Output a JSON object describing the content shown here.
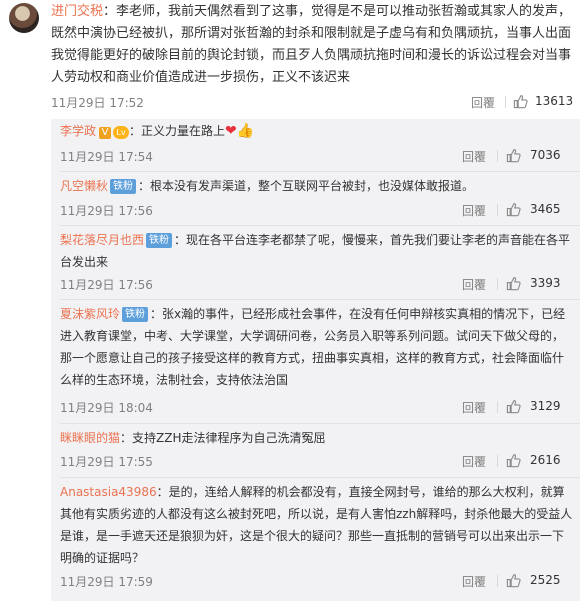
{
  "main_comment": {
    "username": "进门交税",
    "text": "：李老师，我前天偶然看到了这事，觉得是不是可以推动张哲瀚或其家人的发声，既然中演协已经被扒，那所谓对张哲瀚的封杀和限制就是子虚乌有和负隅顽抗，当事人出面我觉得能更好的破除目前的舆论封锁，而且歹人负隅顽抗拖时间和漫长的诉讼过程会对当事人劳动权和商业价值造成进一步损伤，正义不该迟来",
    "date": "11月29日 17:52",
    "reply_label": "回覆",
    "likes": "13613"
  },
  "replies": [
    {
      "username": "李学政",
      "badges": [
        "V",
        "Lv"
      ],
      "text": "：正义力量在路上",
      "emoji": [
        "heart",
        "thumbs-up"
      ],
      "date": "11月29日 17:54",
      "reply_label": "回覆",
      "likes": "7036"
    },
    {
      "username": "凡空懒秋",
      "fan_badge": "铁粉",
      "text": "：根本没有发声渠道，整个互联网平台被封，也没媒体敢报道。",
      "date": "11月29日 17:56",
      "reply_label": "回覆",
      "likes": "3465"
    },
    {
      "username": "梨花落尽月也西",
      "fan_badge": "铁粉",
      "text": "：现在各平台连李老都禁了呢，慢慢来，首先我们要让李老的声音能在各平台发出来",
      "date": "11月29日 17:56",
      "reply_label": "回覆",
      "likes": "3393"
    },
    {
      "username": "夏沫紫风玲",
      "fan_badge": "铁粉",
      "text": "：张x瀚的事件，已经形成社会事件，在没有任何申辩核实真相的情况下，已经进入教育课堂，中考、大学课堂，大学调研问卷，公务员入职等系列问题。试问天下做父母的，那一个愿意让自己的孩子接受这样的教育方式，扭曲事实真相，这样的教育方式，社会降面临什么样的生态环境，法制社会，支持依法治国",
      "date": "11月29日 18:04",
      "reply_label": "回覆",
      "likes": "3129"
    },
    {
      "username": "眯眯眼的猫",
      "text": "：支持ZZH走法律程序为自己洗清冤屈",
      "date": "11月29日 17:55",
      "reply_label": "回覆",
      "likes": "2616"
    },
    {
      "username": "Anastasia43986",
      "text": "：是的，连给人解释的机会都没有，直接全网封号，谁给的那么大权利，就算其他有实质劣迹的人都没有这么被封死吧，所以说，是有人害怕zzh解释吗，封杀他最大的受益人是谁，是一手遮天还是狼狈为奸，这是个很大的疑问？那些一直抵制的营销号可以出来出示一下明确的证据吗？",
      "date": "11月29日 17:59",
      "reply_label": "回覆",
      "likes": "2525"
    }
  ]
}
